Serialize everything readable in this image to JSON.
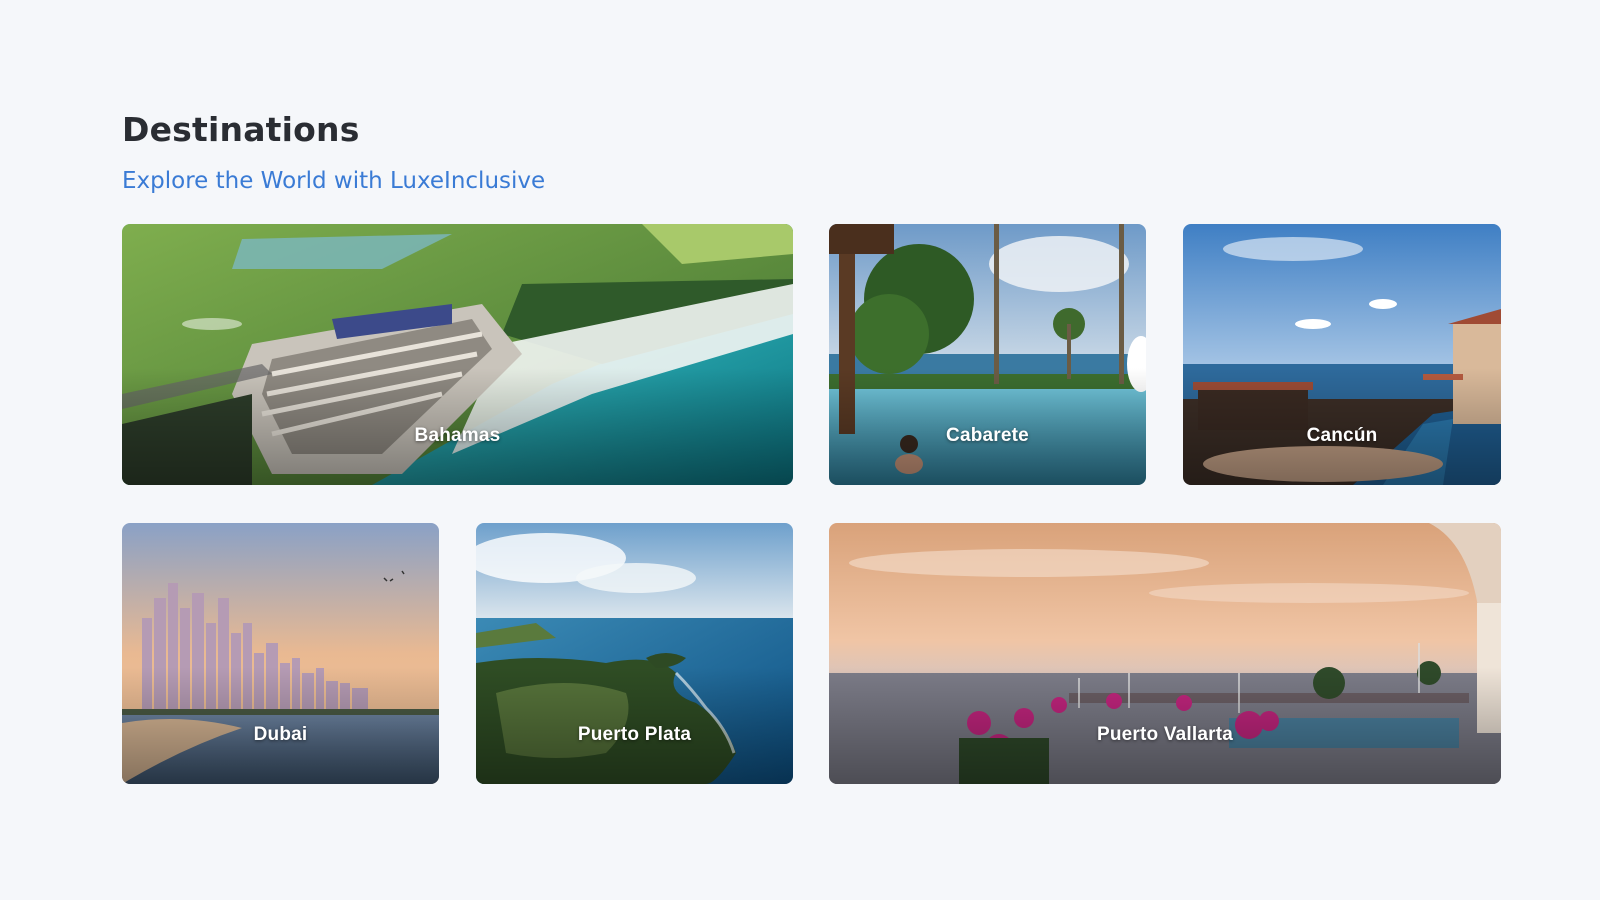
{
  "header": {
    "title": "Destinations",
    "subtitle": "Explore the World with LuxeInclusive"
  },
  "destinations": [
    {
      "name": "Bahamas"
    },
    {
      "name": "Cabarete"
    },
    {
      "name": "Cancún"
    },
    {
      "name": "Dubai"
    },
    {
      "name": "Puerto Plata"
    },
    {
      "name": "Puerto Vallarta"
    }
  ],
  "colors": {
    "background": "#f5f7fa",
    "title": "#2a2d33",
    "subtitle_accent": "#3a7bd5",
    "card_label": "#ffffff"
  }
}
